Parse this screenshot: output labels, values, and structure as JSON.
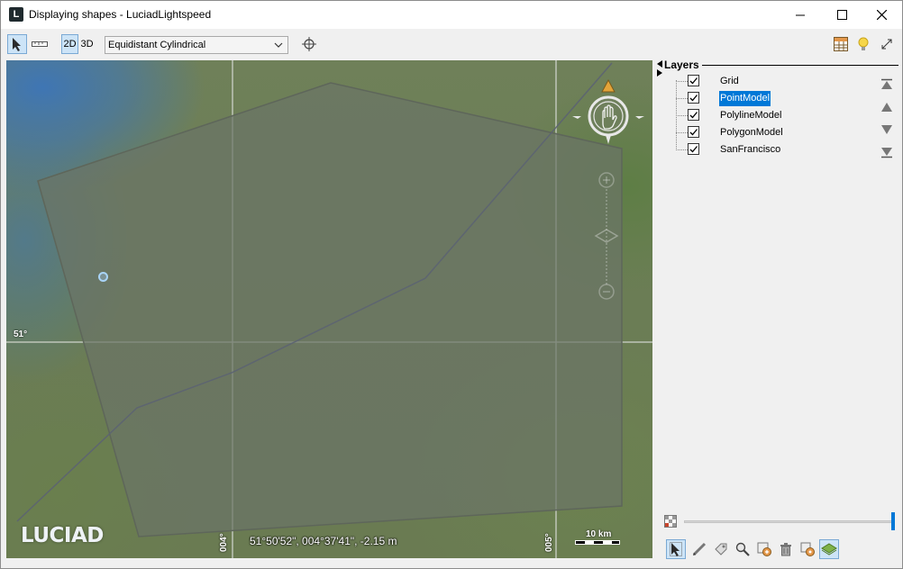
{
  "window": {
    "app_icon_letter": "L",
    "title": "Displaying shapes - LuciadLightspeed"
  },
  "toolbar": {
    "mode_2d": "2D",
    "mode_3d": "3D",
    "projection": "Equidistant Cylindrical"
  },
  "map": {
    "lat_label": "51°",
    "lon_labels": [
      "004°",
      "005°"
    ],
    "logo": "LUCIAD",
    "coordinates": "51°50'52\", 004°37'41\", -2.15 m",
    "scale_label": "10 km"
  },
  "layers": {
    "title": "Layers",
    "items": [
      {
        "name": "Grid",
        "checked": true,
        "selected": false
      },
      {
        "name": "PointModel",
        "checked": true,
        "selected": true
      },
      {
        "name": "PolylineModel",
        "checked": true,
        "selected": false
      },
      {
        "name": "PolygonModel",
        "checked": true,
        "selected": false
      },
      {
        "name": "SanFrancisco",
        "checked": true,
        "selected": false
      }
    ]
  },
  "colors": {
    "accent": "#0078d7",
    "selection_bg": "#cde4f7",
    "polygon_fill": "#6b7466",
    "grid_line": "#c8cdc4"
  },
  "opacity_slider": {
    "value": 1.0
  }
}
